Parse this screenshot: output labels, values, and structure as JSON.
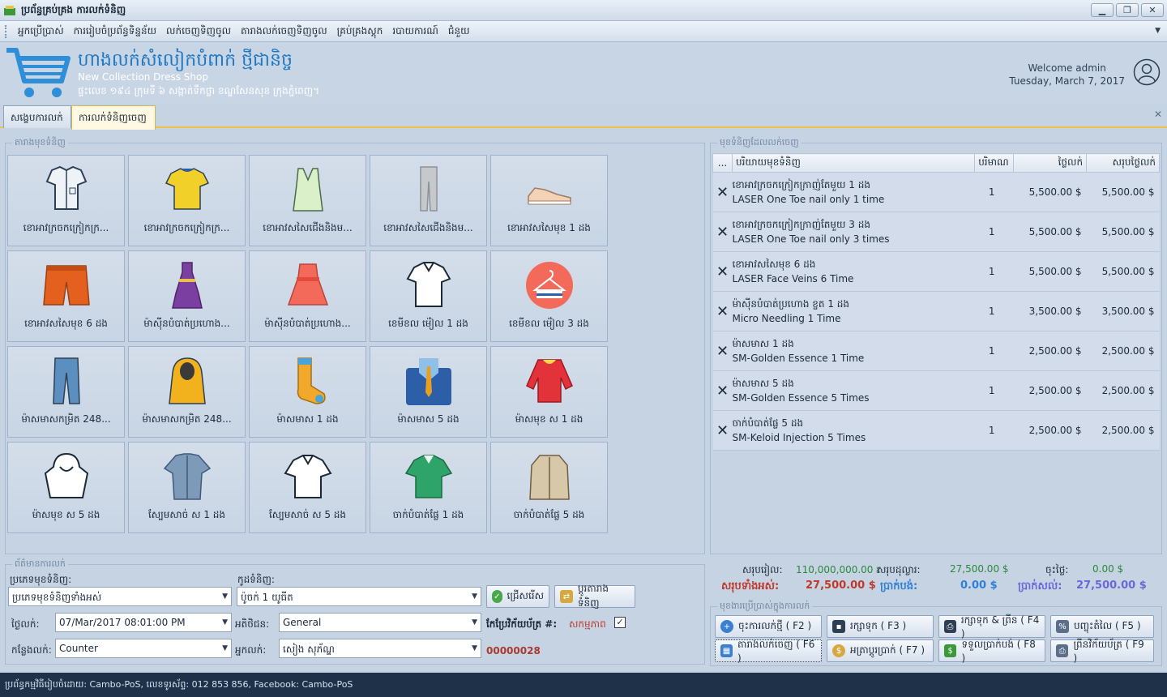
{
  "window": {
    "title": "ប្រព័ន្ធគ្រប់គ្រង ការលក់ទំនិញ"
  },
  "menu": [
    "អ្នកប្រើប្រាស់",
    "ការរៀបចំប្រព័ន្ធទិន្នន័យ",
    "លក់ចេញទិញចូល",
    "តារាងលក់ចេញទិញចូល",
    "គ្រប់គ្រងស្តុក",
    "របាយការណ៍",
    "ជំនួយ"
  ],
  "header": {
    "shop_name": "ហាងលក់សំលៀកបំពាក់ ថ្មីជានិច្ច",
    "shop_name_en": "New Collection Dress Shop",
    "address": "ផ្ទះលេខ ១៩៤ ក្រុមទី ៦ សង្កាត់ទឹកថ្លា ខណ្ឌសែនសុខ ក្រុងភ្នំពេញ។",
    "welcome": "Welcome admin",
    "date": "Tuesday, March 7, 2017"
  },
  "tabs": [
    "សង្ខេបការលក់",
    "ការលក់ទំនិញចេញ"
  ],
  "catalog": {
    "legend": "តារាងមុខទំនិញ",
    "items": [
      {
        "label": "ខោអាវក្រចកក្រៀកក្រ...",
        "icon": "shirt-checked-icon"
      },
      {
        "label": "ខោអាវក្រចកក្រៀកក្រ...",
        "icon": "tshirt-yellow-icon"
      },
      {
        "label": "ខោអាវសសៃជើងនិងម...",
        "icon": "tank-top-icon"
      },
      {
        "label": "ខោអាវសសៃជើងនិងម...",
        "icon": "leggings-icon"
      },
      {
        "label": "ខោអាវសសៃមុខ 1 ដង",
        "icon": "sneaker-icon"
      },
      {
        "label": "ខោអាវសសៃមុខ 6 ដង",
        "icon": "shorts-icon"
      },
      {
        "label": "ម៉ាស៊ីនបំបាត់ប្រហោង...",
        "icon": "dress-purple-icon"
      },
      {
        "label": "ម៉ាស៊ីនបំបាត់ប្រហោង...",
        "icon": "dress-pink-icon"
      },
      {
        "label": "ខេមីខល ម៉ៀល 1 ដង",
        "icon": "polo-outline-icon"
      },
      {
        "label": "ខេមីខល ម៉ៀល 3 ដង",
        "icon": "hanger-icon"
      },
      {
        "label": "ម៉ាសមាសកម្រិត 248...",
        "icon": "jeans-icon"
      },
      {
        "label": "ម៉ាសមាសកម្រិត 248...",
        "icon": "jacket-hood-icon"
      },
      {
        "label": "ម៉ាសមាស 1 ដង",
        "icon": "sock-icon"
      },
      {
        "label": "ម៉ាសមាស 5 ដង",
        "icon": "suit-tie-icon"
      },
      {
        "label": "ម៉ាសមុខ ស 1 ដង",
        "icon": "sweater-red-icon"
      },
      {
        "label": "ម៉ាសមុខ ស 5 ដង",
        "icon": "hoodie-icon"
      },
      {
        "label": "ស្បែមសាច់ ស 1 ដង",
        "icon": "denim-shirt-icon"
      },
      {
        "label": "ស្បែមសាច់ ស 5 ដង",
        "icon": "polo-black-icon"
      },
      {
        "label": "ចាក់បំបាត់ផ្លែ 1 ដង",
        "icon": "polo-green-icon"
      },
      {
        "label": "ចាក់បំបាត់ផ្លែ 5 ដង",
        "icon": "cardigan-icon"
      }
    ]
  },
  "order": {
    "legend": "មុខទំនិញដែលលក់ចេញ",
    "columns": [
      "...",
      "បរិយាយមុខទំនិញ",
      "បរិមាណ",
      "ថ្លៃលក់",
      "សរុបថ្លៃលក់"
    ],
    "rows": [
      {
        "name": "ខោអាវក្រចកក្រៀកក្រាញ់តែមួយ 1 ដង",
        "sub": "LASER One Toe nail only 1 time",
        "qty": "1",
        "price": "5,500.00 $",
        "total": "5,500.00 $"
      },
      {
        "name": "ខោអាវក្រចកក្រៀកក្រាញ់តែមួយ 3 ដង",
        "sub": "LASER One Toe nail only 3 times",
        "qty": "1",
        "price": "5,500.00 $",
        "total": "5,500.00 $"
      },
      {
        "name": "ខោអាវសសៃមុខ 6 ដង",
        "sub": "LASER Face Veins 6 Time",
        "qty": "1",
        "price": "5,500.00 $",
        "total": "5,500.00 $"
      },
      {
        "name": "ម៉ាស៊ីនបំបាត់ប្រហោង ខ្ចត 1 ដង",
        "sub": "Micro Needling 1 Time",
        "qty": "1",
        "price": "3,500.00 $",
        "total": "3,500.00 $"
      },
      {
        "name": "ម៉ាសមាស 1 ដង",
        "sub": "SM-Golden Essence 1 Time",
        "qty": "1",
        "price": "2,500.00 $",
        "total": "2,500.00 $"
      },
      {
        "name": "ម៉ាសមាស 5 ដង",
        "sub": "SM-Golden Essence 5 Times",
        "qty": "1",
        "price": "2,500.00 $",
        "total": "2,500.00 $"
      },
      {
        "name": "ចាក់បំបាត់ផ្លែ 5 ដង",
        "sub": "SM-Keloid Injection 5 Times",
        "qty": "1",
        "price": "2,500.00 $",
        "total": "2,500.00 $"
      }
    ]
  },
  "summary": {
    "riel_label": "សរុបរៀល:",
    "riel": "110,000,000.00 ៛",
    "usd_label": "សរុបដុល្លារ:",
    "usd": "27,500.00 $",
    "discount_label": "ចុះថ្លៃ:",
    "discount": "0.00 $",
    "grand_label": "សរុបទាំងអស់:",
    "grand": "27,500.00 $",
    "paid_label": "ប្រាក់បង់:",
    "paid": "0.00 $",
    "remain_label": "ប្រាក់សល់:",
    "remain": "27,500.00 $"
  },
  "sale_info": {
    "legend": "ព័ត៌មានការលក់",
    "category_label": "ប្រភេទមុខទំនិញ:",
    "category_value": "ប្រភេទមុខទំនិញទាំងអស់",
    "code_label": "កូដទំនិញ:",
    "code_value": "ប៉ូចក់ 1 យូធីត",
    "select_btn": "ជ្រើសរើស",
    "change_btn": "ប្តូរតារាងទំនិញ",
    "date_label": "ថ្ងៃលក់:",
    "date_value": "07/Mar/2017 08:01:00 PM",
    "customer_label": "អតិថិជន:",
    "customer_value": "General",
    "invoice_label": "កែប្រែវិក័យប័ត្រ #:",
    "status_label": "សកម្មភាព",
    "place_label": "កន្លែងលក់:",
    "place_value": "Counter",
    "seller_label": "អ្នកលក់:",
    "seller_value": "សៀង សុភ័ណ្ឌ",
    "invoice_no": "00000028"
  },
  "actions": {
    "legend": "មុខងារប្រើប្រាស់ក្នុងការលក់",
    "new_sale": "ចុះការលក់ថ្មី ( F2 )",
    "save": "រក្សាទុក ( F3 )",
    "save_print": "រក្សាទុក & ព្រីន ( F4 )",
    "discount": "បញ្ចុះតំលៃ ( F5 )",
    "sale_table": "តារាងលក់ចេញ ( F6 )",
    "exchange": "អត្រាប្តូរប្រាក់ ( F7 )",
    "receive": "ទទួលប្រាក់បង់ ( F8 )",
    "print_invoice": "ព្រីនវិក័យប័ត្រ ( F9 )"
  },
  "footer": "ប្រព័ន្ធកម្មវិធីរៀបចំដោយ: Cambo-PoS, លេខទូរស័ព្ទ: 012 853 856, Facebook: Cambo-PoS"
}
